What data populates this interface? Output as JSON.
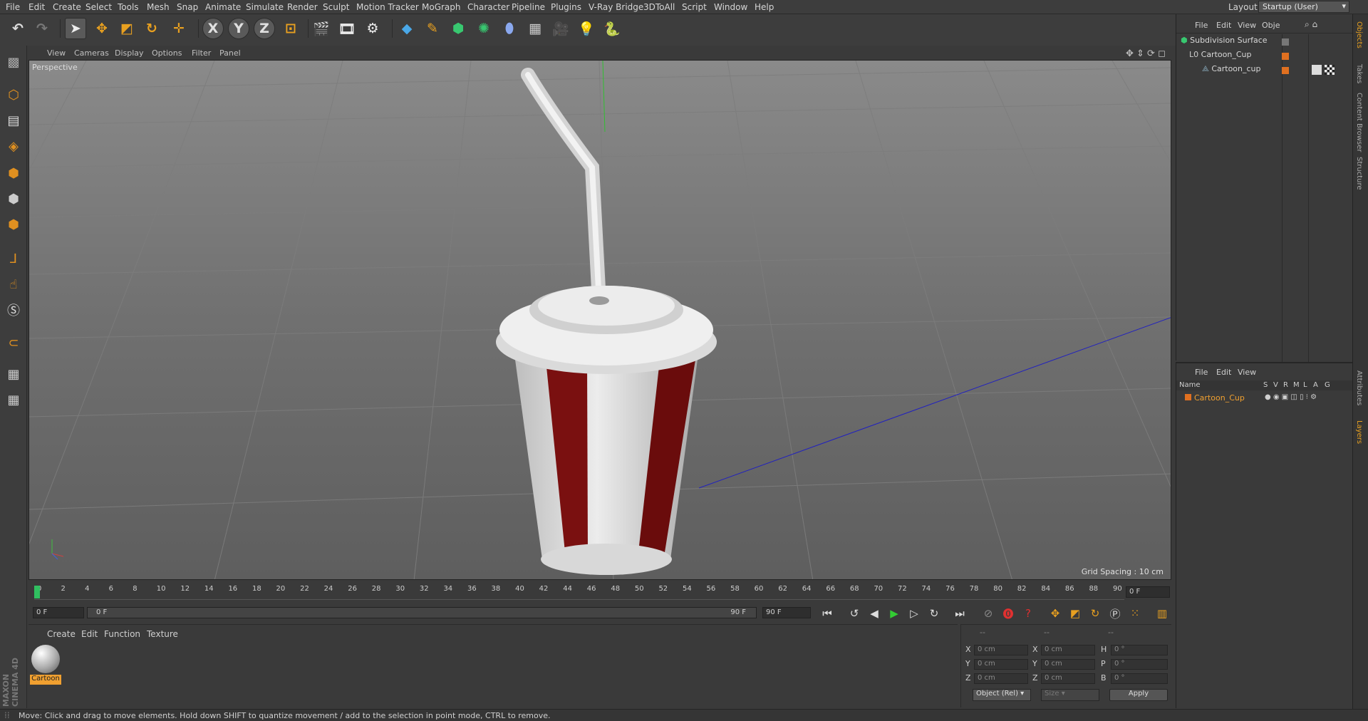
{
  "menubar": {
    "items": [
      "File",
      "Edit",
      "Create",
      "Select",
      "Tools",
      "Mesh",
      "Snap",
      "Animate",
      "Simulate",
      "Render",
      "Sculpt",
      "Motion Tracker",
      "MoGraph",
      "Character",
      "Pipeline",
      "Plugins",
      "V-Ray Bridge",
      "3DToAll",
      "Script",
      "Window",
      "Help"
    ],
    "layout_label": "Layout:",
    "layout_value": "Startup (User)"
  },
  "toolbar": {
    "axis_x": "X",
    "axis_y": "Y",
    "axis_z": "Z"
  },
  "viewport": {
    "menu": [
      "View",
      "Cameras",
      "Display",
      "Options",
      "Filter",
      "Panel"
    ],
    "camera_label": "Perspective",
    "grid_spacing": "Grid Spacing : 10 cm"
  },
  "timeline": {
    "ticks": [
      "0",
      "2",
      "4",
      "6",
      "8",
      "10",
      "12",
      "14",
      "16",
      "18",
      "20",
      "22",
      "24",
      "26",
      "28",
      "30",
      "32",
      "34",
      "36",
      "38",
      "40",
      "42",
      "44",
      "46",
      "48",
      "50",
      "52",
      "54",
      "56",
      "58",
      "60",
      "62",
      "64",
      "66",
      "68",
      "70",
      "72",
      "74",
      "76",
      "78",
      "80",
      "82",
      "84",
      "86",
      "88",
      "90"
    ],
    "current_frame": "0 F"
  },
  "playbar": {
    "start_field": "0 F",
    "range_start": "0 F",
    "range_end": "90 F",
    "end_field": "90 F"
  },
  "material_panel": {
    "menu": [
      "Create",
      "Edit",
      "Function",
      "Texture"
    ],
    "material_name": "Cartoon"
  },
  "coord_panel": {
    "headers": [
      "--",
      "--",
      "--"
    ],
    "rows": [
      {
        "axis": "X",
        "pos": "0 cm",
        "axis2": "X",
        "size": "0 cm",
        "rot_axis": "H",
        "rot": "0 °"
      },
      {
        "axis": "Y",
        "pos": "0 cm",
        "axis2": "Y",
        "size": "0 cm",
        "rot_axis": "P",
        "rot": "0 °"
      },
      {
        "axis": "Z",
        "pos": "0 cm",
        "axis2": "Z",
        "size": "0 cm",
        "rot_axis": "B",
        "rot": "0 °"
      }
    ],
    "mode_select": "Object (Rel)",
    "size_select": "Size",
    "apply": "Apply"
  },
  "object_manager": {
    "menu": [
      "File",
      "Edit",
      "View",
      "Obje"
    ],
    "objects": [
      {
        "name": "Subdivision Surface",
        "level": 0
      },
      {
        "name": "Cartoon_Cup",
        "level": 1
      },
      {
        "name": "Cartoon_cup",
        "level": 2
      }
    ]
  },
  "layer_manager": {
    "menu": [
      "File",
      "Edit",
      "View"
    ],
    "columns": [
      "Name",
      "S",
      "V",
      "R",
      "M",
      "L",
      "A",
      "G"
    ],
    "layers": [
      {
        "name": "Cartoon_Cup",
        "color": "#e07020"
      }
    ]
  },
  "right_tabs": [
    "Objects",
    "Takes",
    "Content Browser",
    "Structure",
    "Attributes",
    "Layers"
  ],
  "status": "Move: Click and drag to move elements. Hold down SHIFT to quantize movement / add to the selection in point mode, CTRL to remove.",
  "brand": "MAXON CINEMA 4D",
  "colors": {
    "accent": "#e8a020",
    "selection": "#f0a030",
    "cup_red": "#7a1010"
  }
}
